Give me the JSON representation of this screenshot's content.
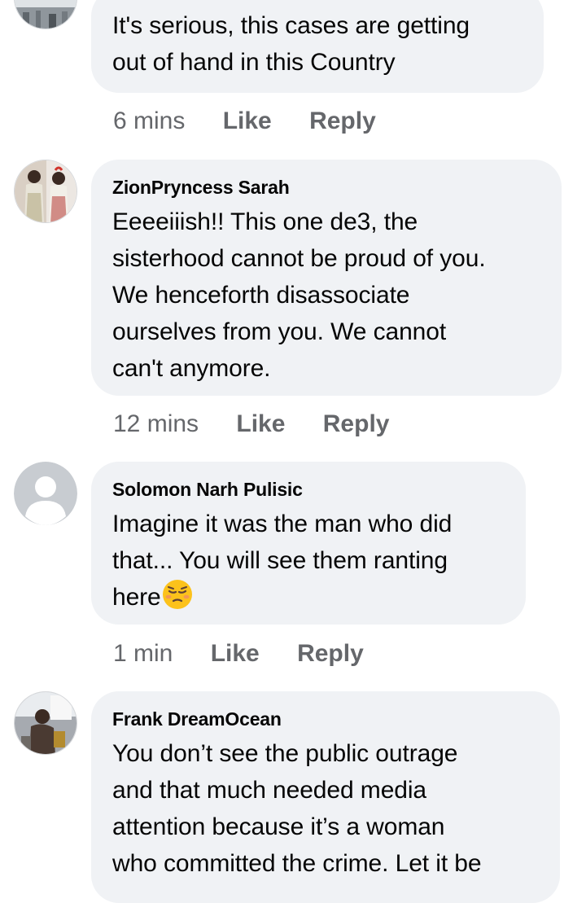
{
  "comments": [
    {
      "author": "",
      "lines": [
        "It's serious, this cases are getting",
        "out of hand in this Country"
      ],
      "time": "6 mins",
      "like": "Like",
      "reply": "Reply"
    },
    {
      "author": "ZionPryncess Sarah",
      "lines": [
        "Eeeeiiish!! This one de3, the",
        "sisterhood cannot be proud of you.",
        "We henceforth disassociate",
        "ourselves from you. We cannot",
        "can't anymore."
      ],
      "time": "12 mins",
      "like": "Like",
      "reply": "Reply"
    },
    {
      "author": "Solomon Narh Pulisic",
      "lines": [
        "Imagine it was the man who did",
        "that...  You will see them ranting",
        "here"
      ],
      "emoji": "pensive-face-emoji",
      "time": "1 min",
      "like": "Like",
      "reply": "Reply"
    },
    {
      "author": "Frank DreamOcean",
      "lines": [
        "You don’t see the public outrage",
        "and that much needed media",
        "attention because it’s a woman",
        "who committed the crime. Let it be"
      ],
      "time": "",
      "like": "",
      "reply": ""
    }
  ],
  "colors": {
    "bubble": "#f0f2f5",
    "meta_text": "#65676b",
    "body_text": "#050505"
  },
  "icons": [
    "default-avatar-icon",
    "pensive-face-emoji"
  ]
}
